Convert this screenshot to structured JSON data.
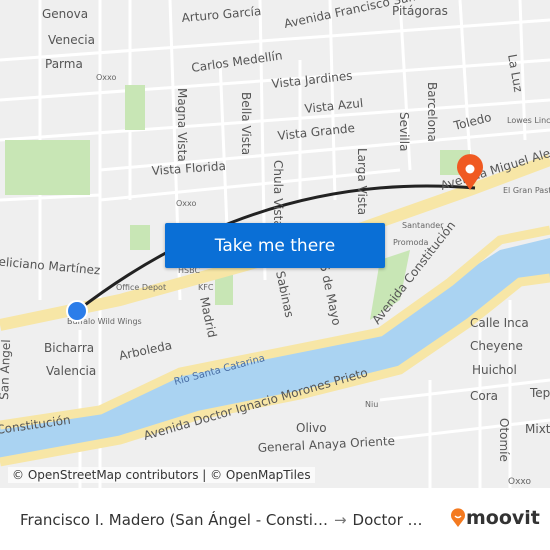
{
  "map": {
    "labels": {
      "genova": "Genova",
      "venecia": "Venecia",
      "parma": "Parma",
      "arturo_garcia": "Arturo García",
      "av_fco_samohano": "Avenida Francisco Samohano",
      "pitagoras": "Pitágoras",
      "carlos_medellin": "Carlos Medellín",
      "la_luz": "La Luz",
      "vista_jardines": "Vista Jardines",
      "vista_azul": "Vista Azul",
      "vista_grande": "Vista Grande",
      "vista_florida": "Vista Florida",
      "magna_vista": "Magna Vista",
      "bella_vista": "Bella Vista",
      "chula_vista": "Chula Vista",
      "larga_vista": "Larga Vista",
      "sevilla": "Sevilla",
      "barcelona": "Barcelona",
      "toledo": "Toledo",
      "lowes": "Lowes Linc",
      "av_miguel_aleman": "Avenida Miguel Alemán",
      "el_gran_pastor": "El Gran Pastor",
      "santander": "Santander",
      "promoda": "Promoda",
      "av_constitucion": "Avenida Constitución",
      "av_constitucion_w": "Constitución",
      "feliciano": "Feliciano Martínez",
      "hsbc": "HSBC",
      "office_depot": "Office Depot",
      "kfc": "KFC",
      "oxxo1": "Oxxo",
      "oxxo2": "Oxxo",
      "oxxo3": "Oxxo",
      "buffalo": "Buffalo Wild Wings",
      "madrid": "Madrid",
      "sabinas": "Sabinas",
      "cinco_mayo": "5 de Mayo",
      "bicharra": "Bicharra",
      "valencia": "Valencia",
      "arboleda": "Arboleda",
      "san_angel": "San Ángel",
      "rio": "Río Santa Catarina",
      "av_morones": "Avenida Doctor Ignacio Morones Prieto",
      "olivo": "Olivo",
      "niu": "Niu",
      "gral_anaya": "General Anaya Oriente",
      "calle_inca": "Calle Inca",
      "cheyene": "Cheyene",
      "huichol": "Huichol",
      "cora": "Cora",
      "tep": "Tep",
      "mixt": "Mixt",
      "otomie": "Otomíe"
    },
    "colors": {
      "river": "#aad3f2",
      "highway": "#f7e6a6",
      "route": "#222222",
      "origin": "#2b7de9",
      "destination": "#f05a22",
      "button": "#0a6fd6"
    },
    "origin_icon": "origin-dot-icon",
    "destination_icon": "map-pin-icon"
  },
  "cta": {
    "label": "Take me there"
  },
  "attribution": "© OpenStreetMap contributors | © OpenMapTiles",
  "footer": {
    "from": "Francisco I. Madero (San Ángel - Consti…",
    "arrow": "→",
    "to": "Doctor …",
    "logo": "moovit"
  }
}
